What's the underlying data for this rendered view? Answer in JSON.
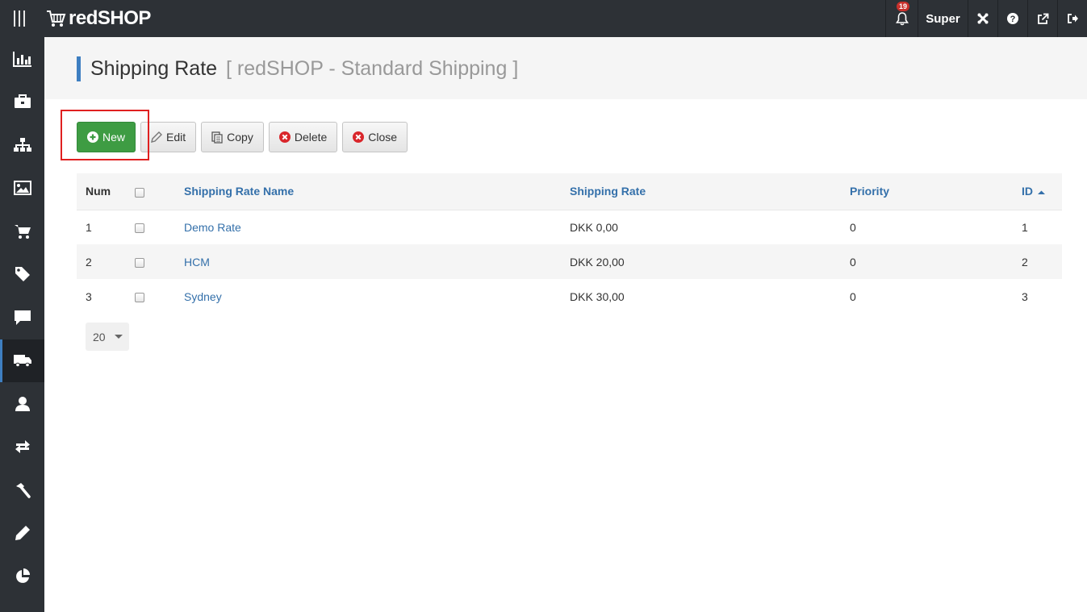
{
  "app": {
    "brand": "redSHOP",
    "notification_count": "19",
    "user_label": "Super"
  },
  "sidebar": {
    "items": [
      {
        "icon": "bar-chart-icon"
      },
      {
        "icon": "briefcase-icon"
      },
      {
        "icon": "sitemap-icon"
      },
      {
        "icon": "image-icon"
      },
      {
        "icon": "cart-icon"
      },
      {
        "icon": "tag-icon"
      },
      {
        "icon": "comment-icon"
      },
      {
        "icon": "truck-icon",
        "active": true
      },
      {
        "icon": "user-icon"
      },
      {
        "icon": "exchange-icon"
      },
      {
        "icon": "hammer-icon"
      },
      {
        "icon": "pencil-icon"
      },
      {
        "icon": "pie-chart-icon"
      }
    ]
  },
  "header": {
    "title": "Shipping Rate",
    "subtitle": "[ redSHOP - Standard Shipping ]"
  },
  "toolbar": {
    "new_label": "New",
    "edit_label": "Edit",
    "copy_label": "Copy",
    "delete_label": "Delete",
    "close_label": "Close"
  },
  "table": {
    "columns": {
      "num": "Num",
      "name": "Shipping Rate Name",
      "rate": "Shipping Rate",
      "priority": "Priority",
      "id": "ID"
    },
    "rows": [
      {
        "num": "1",
        "name": "Demo Rate",
        "rate": "DKK 0,00",
        "priority": "0",
        "id": "1"
      },
      {
        "num": "2",
        "name": "HCM",
        "rate": "DKK 20,00",
        "priority": "0",
        "id": "2"
      },
      {
        "num": "3",
        "name": "Sydney",
        "rate": "DKK 30,00",
        "priority": "0",
        "id": "3"
      }
    ]
  },
  "pagination": {
    "limit": "20"
  },
  "colors": {
    "topbar": "#2d3136",
    "accent": "#3e7fc1",
    "primary_button": "#3e9c43",
    "highlight": "#e02020"
  }
}
